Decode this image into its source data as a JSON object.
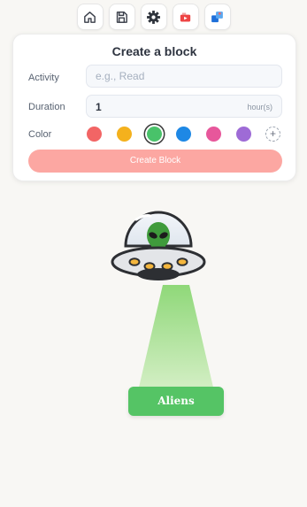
{
  "toolbar": {
    "items": [
      {
        "icon": "home-icon"
      },
      {
        "icon": "save-icon"
      },
      {
        "icon": "gear-icon"
      },
      {
        "icon": "video-icon"
      },
      {
        "icon": "share-icon"
      }
    ]
  },
  "form": {
    "title": "Create a block",
    "activity_label": "Activity",
    "activity_placeholder": "e.g., Read",
    "activity_value": "",
    "duration_label": "Duration",
    "duration_value": "1",
    "duration_unit": "hour(s)",
    "color_label": "Color",
    "colors": [
      "#f26565",
      "#f4b11d",
      "#49c26a",
      "#1e88e5",
      "#e7579b",
      "#9e6bd6"
    ],
    "selected_color_index": 2,
    "add_color_symbol": "+",
    "create_label": "Create Block"
  },
  "scene": {
    "illustration": "ufo-alien",
    "button_label": "Aliens"
  }
}
